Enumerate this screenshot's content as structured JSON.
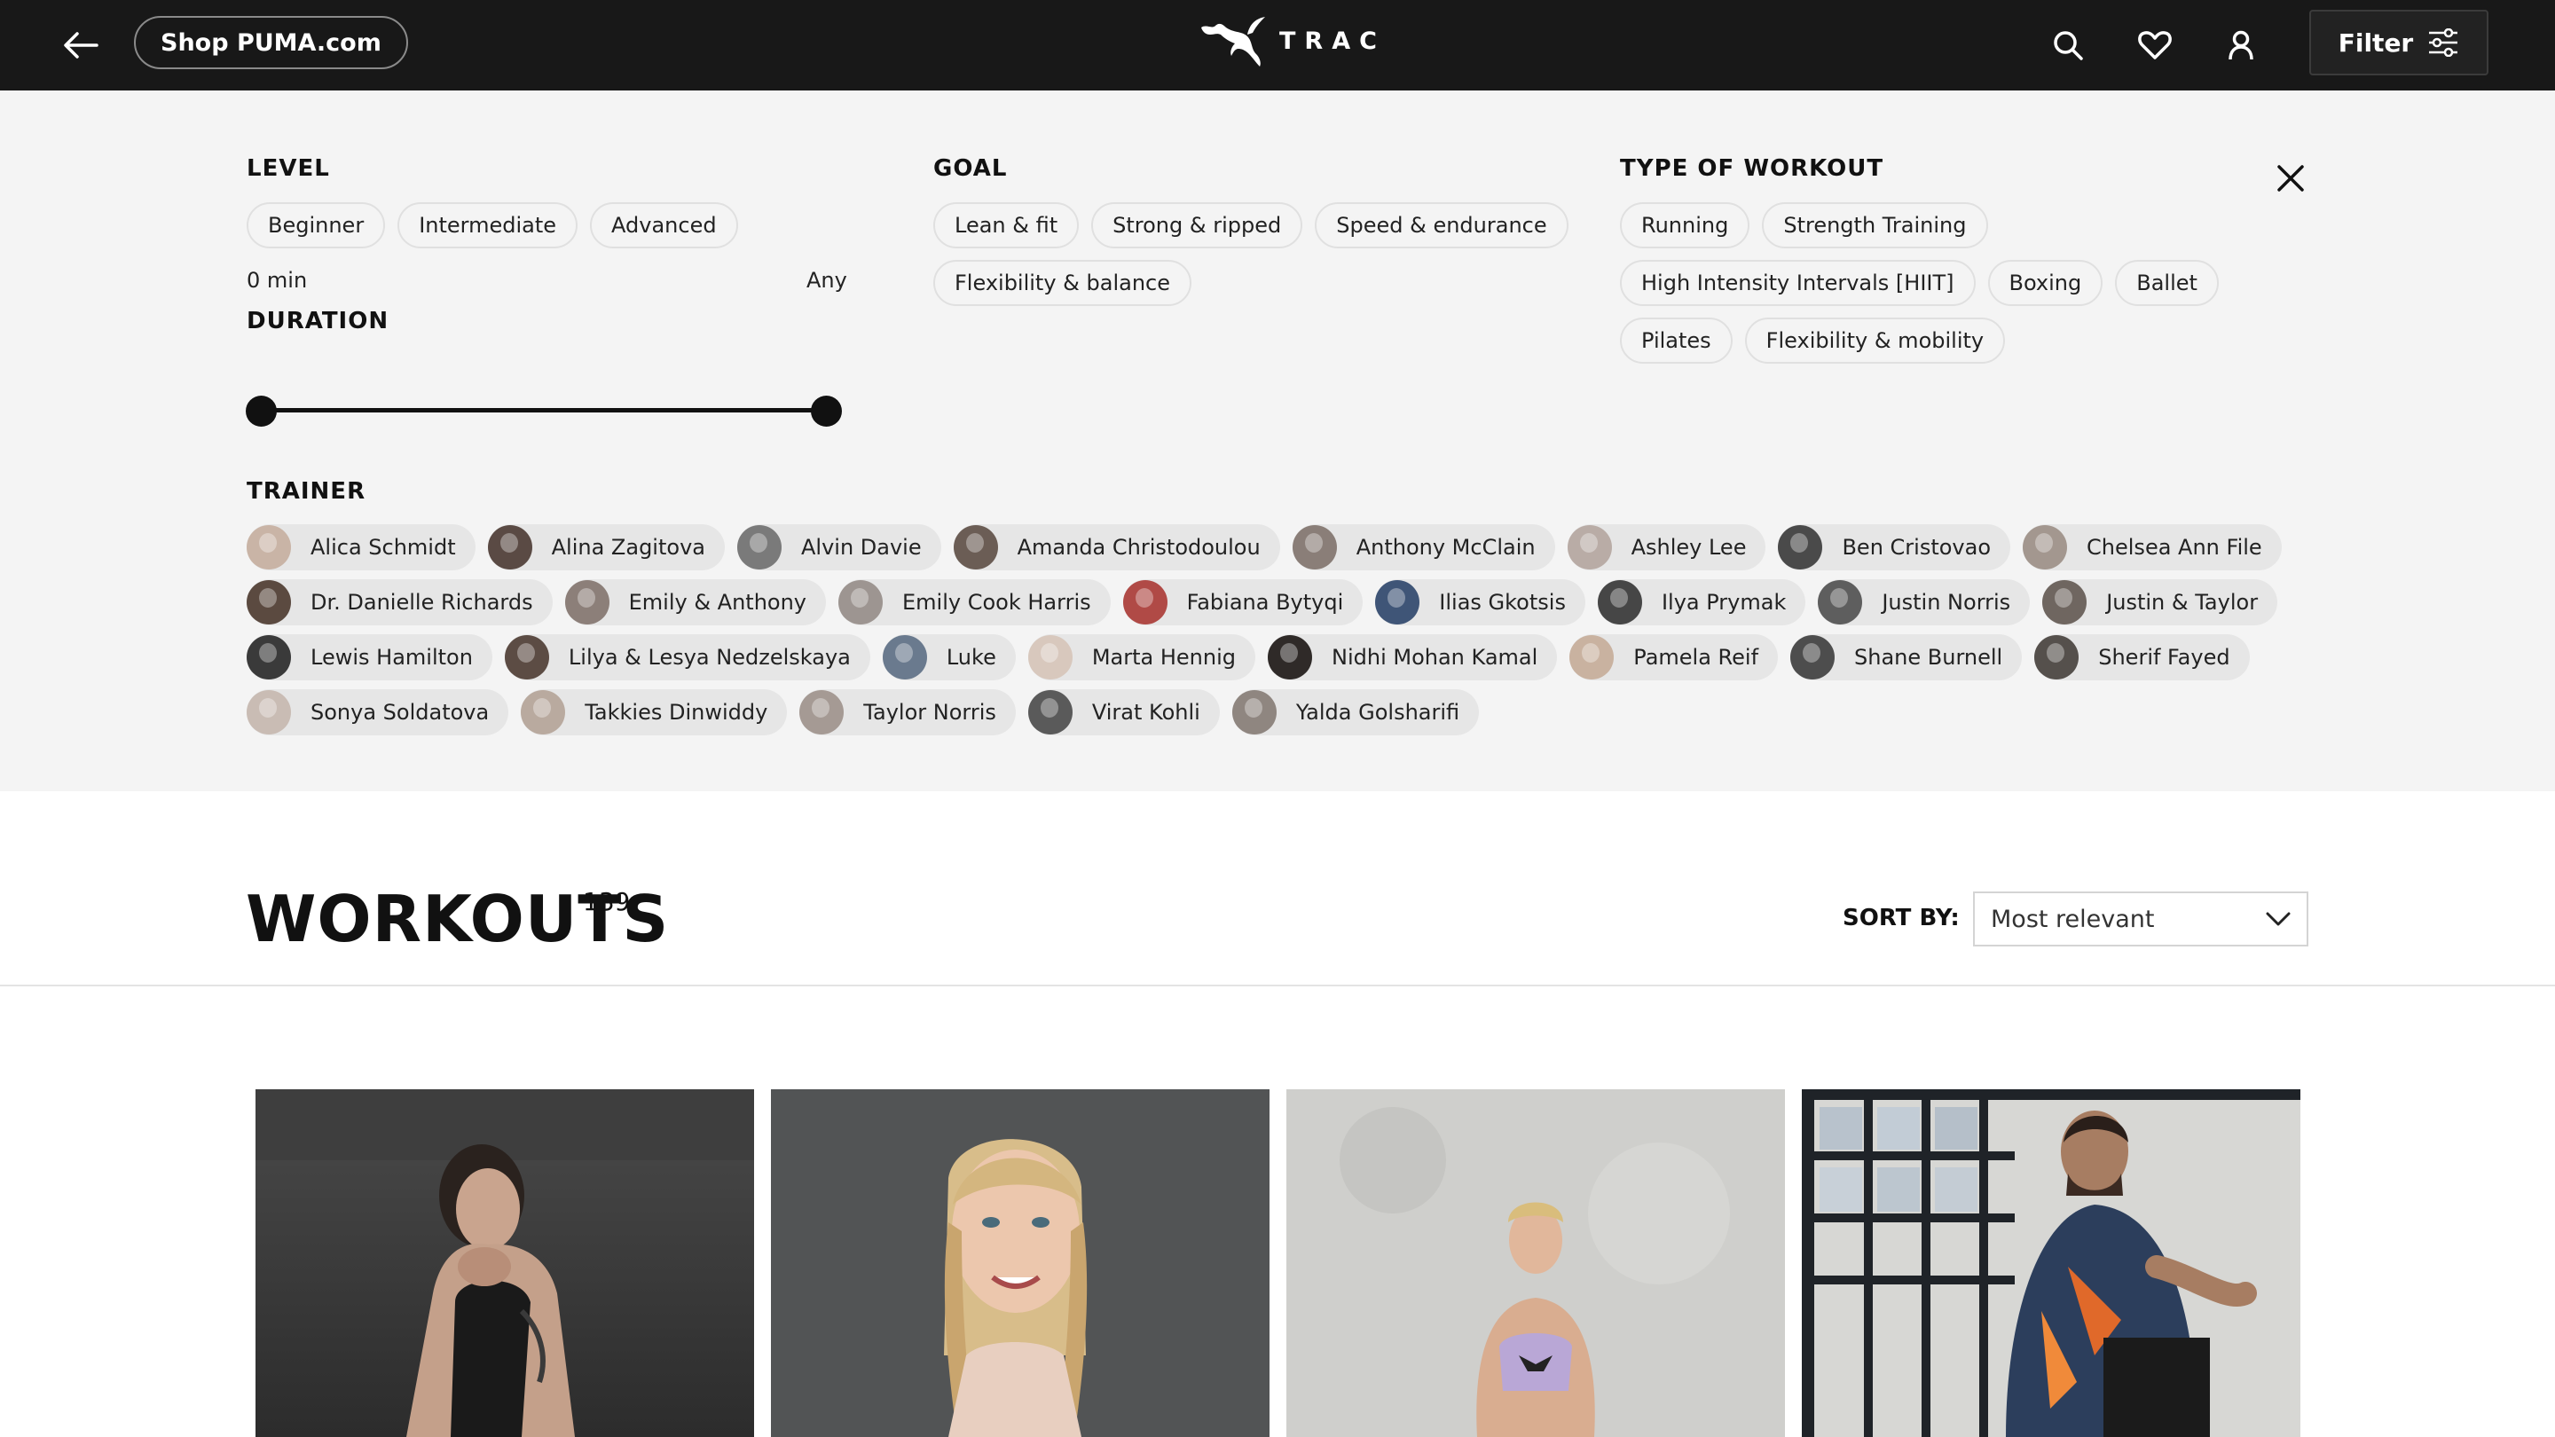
{
  "topbar": {
    "shop_label": "Shop PUMA.com",
    "logo_text": "TRAC",
    "filter_label": "Filter",
    "icons": [
      "back-arrow-icon",
      "puma-logo",
      "search-icon",
      "heart-icon",
      "user-icon",
      "sliders-icon"
    ]
  },
  "filters": {
    "level": {
      "title": "LEVEL",
      "options": [
        "Beginner",
        "Intermediate",
        "Advanced"
      ]
    },
    "goal": {
      "title": "GOAL",
      "options_row1": [
        "Lean & fit",
        "Strong & ripped",
        "Speed & endurance"
      ],
      "options_row2": [
        "Flexibility & balance"
      ]
    },
    "type": {
      "title": "TYPE OF WORKOUT",
      "options_row1": [
        "Running",
        "Strength Training"
      ],
      "options_row2": [
        "High Intensity Intervals [HIIT]",
        "Boxing",
        "Ballet"
      ],
      "options_row3": [
        "Pilates",
        "Flexibility & mobility"
      ]
    },
    "duration": {
      "title": "DURATION",
      "min_label": "0 min",
      "max_label": "Any"
    },
    "trainer": {
      "title": "TRAINER",
      "row1": [
        "Alica Schmidt",
        "Alina Zagitova",
        "Alvin Davie",
        "Amanda Christodoulou",
        "Anthony McClain",
        "Ashley Lee",
        "Ben Cristovao",
        "Chelsea Ann File"
      ],
      "row2": [
        "Dr. Danielle Richards",
        "Emily & Anthony",
        "Emily Cook Harris",
        "Fabiana Bytyqi",
        "Ilias Gkotsis",
        "Ilya Prymak",
        "Justin Norris",
        "Justin & Taylor"
      ],
      "row3": [
        "Lewis Hamilton",
        "Lilya & Lesya Nedzelskaya",
        "Luke",
        "Marta Hennig",
        "Nidhi Mohan Kamal",
        "Pamela Reif",
        "Shane Burnell",
        "Sherif Fayed"
      ],
      "row4": [
        "Sonya Soldatova",
        "Takkies Dinwiddy",
        "Taylor Norris",
        "Virat Kohli",
        "Yalda Golsharifi"
      ]
    }
  },
  "workouts": {
    "title": "WORKOUTS",
    "count": "139",
    "sort_label": "SORT BY:",
    "sort_value": "Most relevant"
  },
  "colors": {
    "topbar_bg": "#181818",
    "panel_bg": "#f4f4f4",
    "chip_border": "#e0e0e0",
    "trainer_chip_bg": "#e6e6e6"
  }
}
